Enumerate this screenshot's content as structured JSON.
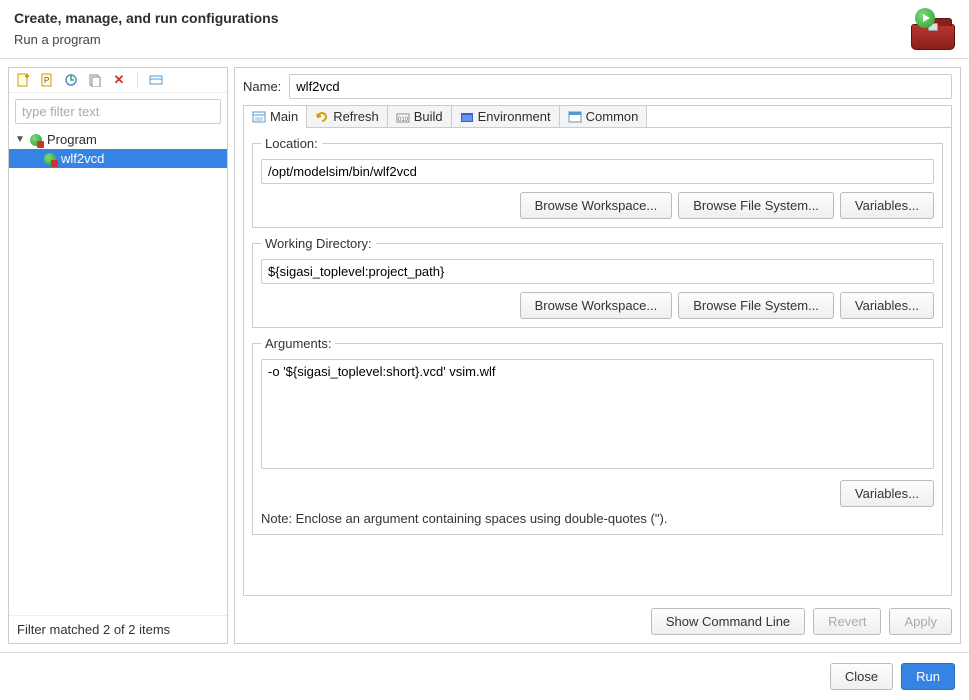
{
  "header": {
    "title": "Create, manage, and run configurations",
    "subtitle": "Run a program"
  },
  "sidebar": {
    "filter_placeholder": "type filter text",
    "tree": {
      "root_label": "Program",
      "child_label": "wlf2vcd"
    },
    "footer": "Filter matched 2 of 2 items"
  },
  "main": {
    "name_label": "Name:",
    "name_value": "wlf2vcd",
    "tabs": [
      "Main",
      "Refresh",
      "Build",
      "Environment",
      "Common"
    ],
    "location": {
      "legend": "Location:",
      "value": "/opt/modelsim/bin/wlf2vcd",
      "buttons": [
        "Browse Workspace...",
        "Browse File System...",
        "Variables..."
      ]
    },
    "workdir": {
      "legend": "Working Directory:",
      "value": "${sigasi_toplevel:project_path}",
      "buttons": [
        "Browse Workspace...",
        "Browse File System...",
        "Variables..."
      ]
    },
    "args": {
      "legend": "Arguments:",
      "value": "-o '${sigasi_toplevel:short}.vcd' vsim.wlf",
      "buttons": [
        "Variables..."
      ],
      "note": "Note: Enclose an argument containing spaces using double-quotes (\")."
    },
    "actions": {
      "show_cmd": "Show Command Line",
      "revert": "Revert",
      "apply": "Apply"
    }
  },
  "footer": {
    "close": "Close",
    "run": "Run"
  }
}
